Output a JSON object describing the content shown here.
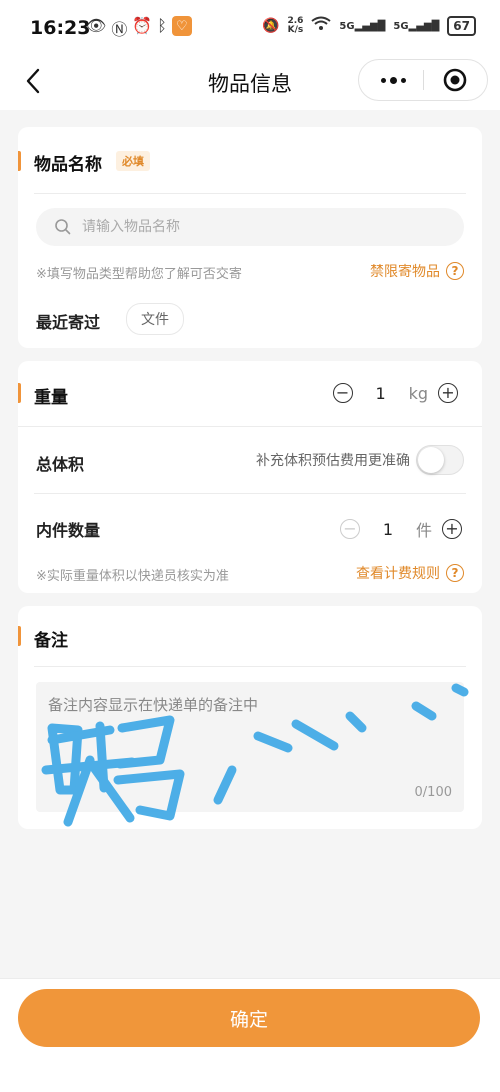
{
  "status_bar": {
    "time": "16:23",
    "net_speed_value": "2.6",
    "net_speed_unit": "K/s",
    "signal1": "5G",
    "signal2": "5G",
    "battery": "67"
  },
  "nav": {
    "title": "物品信息"
  },
  "item_card": {
    "heading": "物品名称",
    "required_tag": "必填",
    "search_placeholder": "请输入物品名称",
    "hint": "※填写物品类型帮助您了解可否交寄",
    "restricted_link": "禁限寄物品",
    "recent_label": "最近寄过",
    "recent_chip": "文件"
  },
  "weight_card": {
    "weight_label": "重量",
    "weight_value": "1",
    "weight_unit": "kg",
    "volume_label": "总体积",
    "volume_hint": "补充体积预估费用更准确",
    "count_label": "内件数量",
    "count_value": "1",
    "count_unit": "件",
    "note": "※实际重量体积以快递员核实为准",
    "fee_link": "查看计费规则"
  },
  "remark_card": {
    "heading": "备注",
    "placeholder": "备注内容显示在快递单的备注中",
    "counter": "0/100"
  },
  "footer": {
    "confirm_label": "确定"
  },
  "colors": {
    "accent": "#f0943a",
    "doodle": "#3fa9e6"
  }
}
